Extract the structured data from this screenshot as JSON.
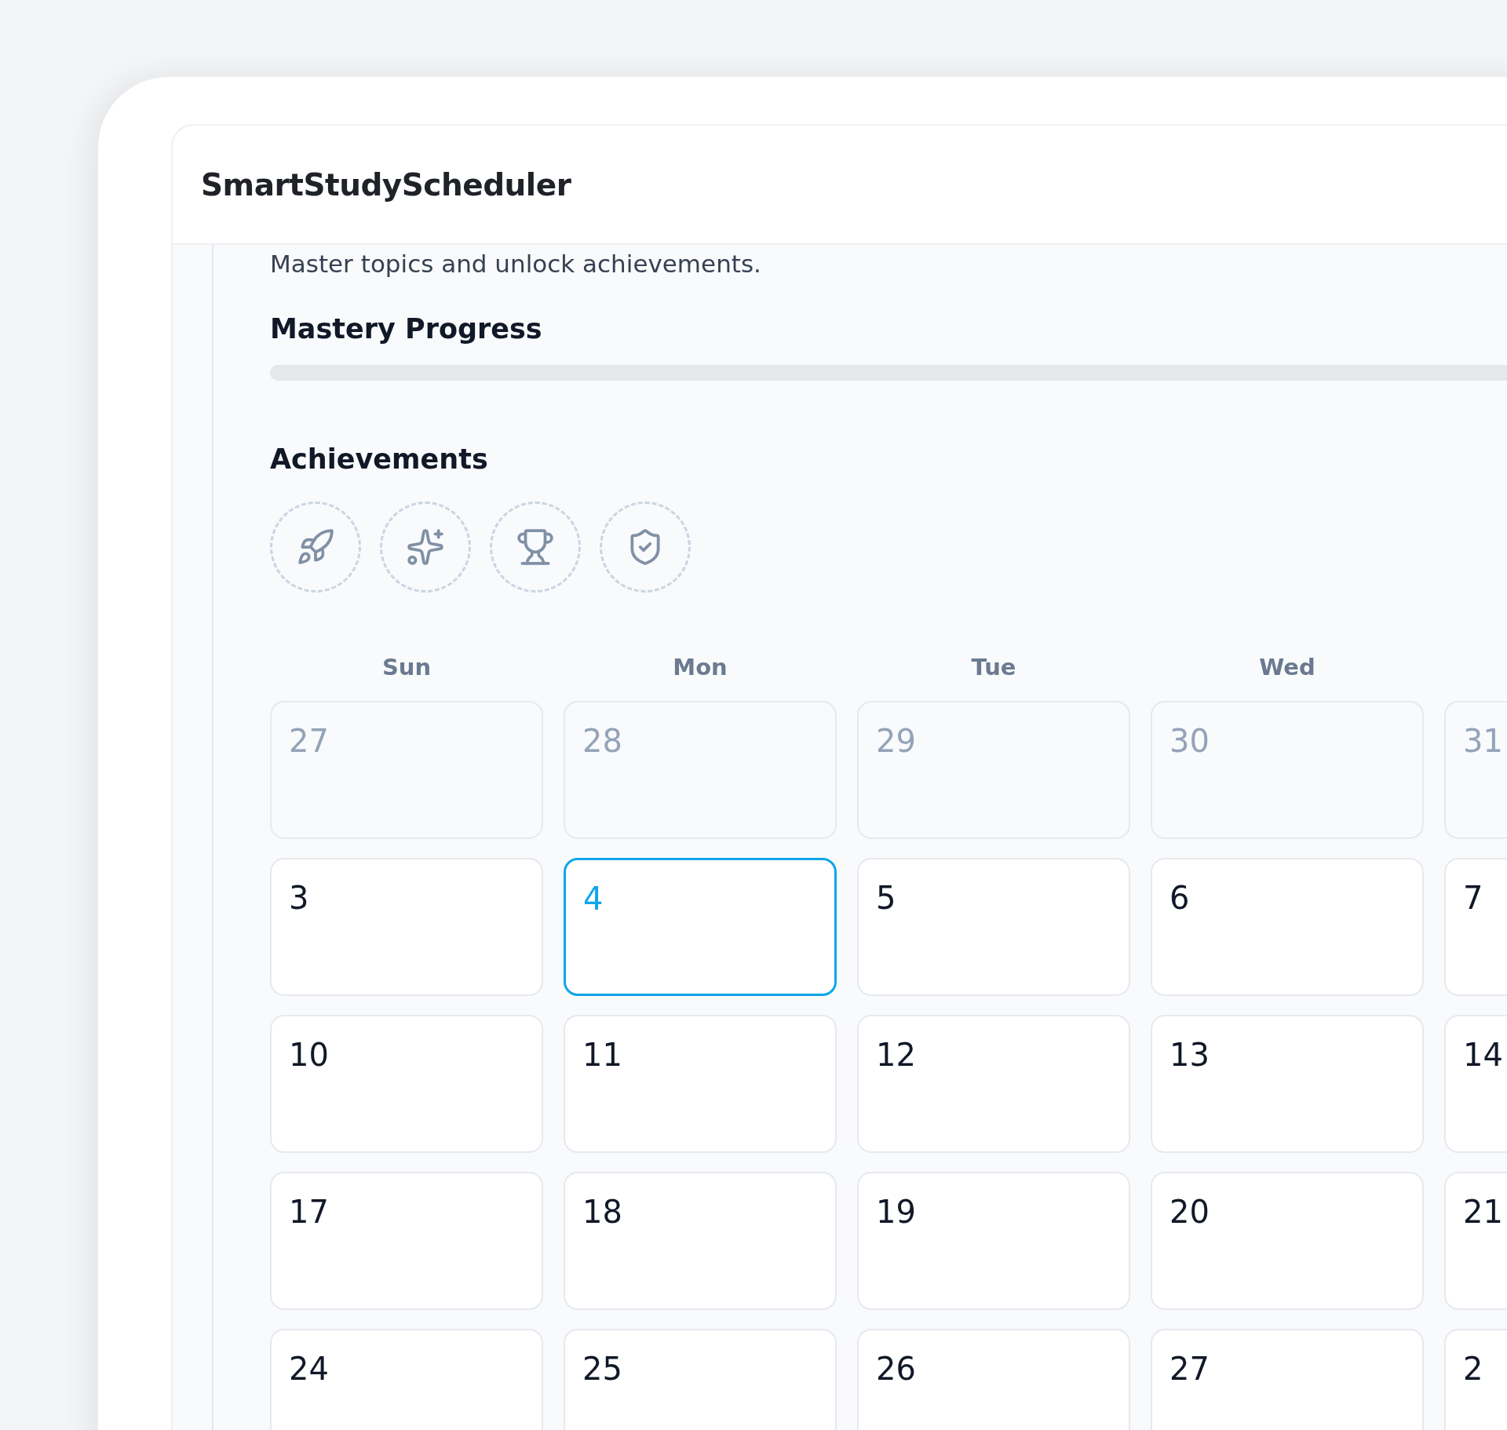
{
  "app": {
    "title": "SmartStudyScheduler"
  },
  "intro": "Master topics and unlock achievements.",
  "mastery": {
    "heading": "Mastery Progress",
    "level": 0
  },
  "achievements": {
    "heading": "Achievements",
    "items": [
      {
        "kind": "rocket",
        "unlocked": false
      },
      {
        "kind": "sparkles",
        "unlocked": false
      },
      {
        "kind": "trophy",
        "unlocked": false
      },
      {
        "kind": "shield",
        "unlocked": false
      }
    ]
  },
  "calendar": {
    "weekdays": [
      "Sun",
      "Mon",
      "Tue",
      "Wed"
    ],
    "weeks": [
      [
        {
          "label": "27",
          "muted": true,
          "selected": false
        },
        {
          "label": "28",
          "muted": true,
          "selected": false
        },
        {
          "label": "29",
          "muted": true,
          "selected": false
        },
        {
          "label": "30",
          "muted": true,
          "selected": false
        },
        {
          "label": "31",
          "muted": true,
          "selected": false
        }
      ],
      [
        {
          "label": "3",
          "muted": false,
          "selected": false
        },
        {
          "label": "4",
          "muted": false,
          "selected": true
        },
        {
          "label": "5",
          "muted": false,
          "selected": false
        },
        {
          "label": "6",
          "muted": false,
          "selected": false
        },
        {
          "label": "7",
          "muted": false,
          "selected": false
        }
      ],
      [
        {
          "label": "10",
          "muted": false,
          "selected": false
        },
        {
          "label": "11",
          "muted": false,
          "selected": false
        },
        {
          "label": "12",
          "muted": false,
          "selected": false
        },
        {
          "label": "13",
          "muted": false,
          "selected": false
        },
        {
          "label": "14",
          "muted": false,
          "selected": false
        }
      ],
      [
        {
          "label": "17",
          "muted": false,
          "selected": false
        },
        {
          "label": "18",
          "muted": false,
          "selected": false
        },
        {
          "label": "19",
          "muted": false,
          "selected": false
        },
        {
          "label": "20",
          "muted": false,
          "selected": false
        },
        {
          "label": "21",
          "muted": false,
          "selected": false
        }
      ],
      [
        {
          "label": "24",
          "muted": false,
          "selected": false
        },
        {
          "label": "25",
          "muted": false,
          "selected": false
        },
        {
          "label": "26",
          "muted": false,
          "selected": false
        },
        {
          "label": "27",
          "muted": false,
          "selected": false
        },
        {
          "label": "2",
          "muted": false,
          "selected": false
        }
      ]
    ]
  }
}
